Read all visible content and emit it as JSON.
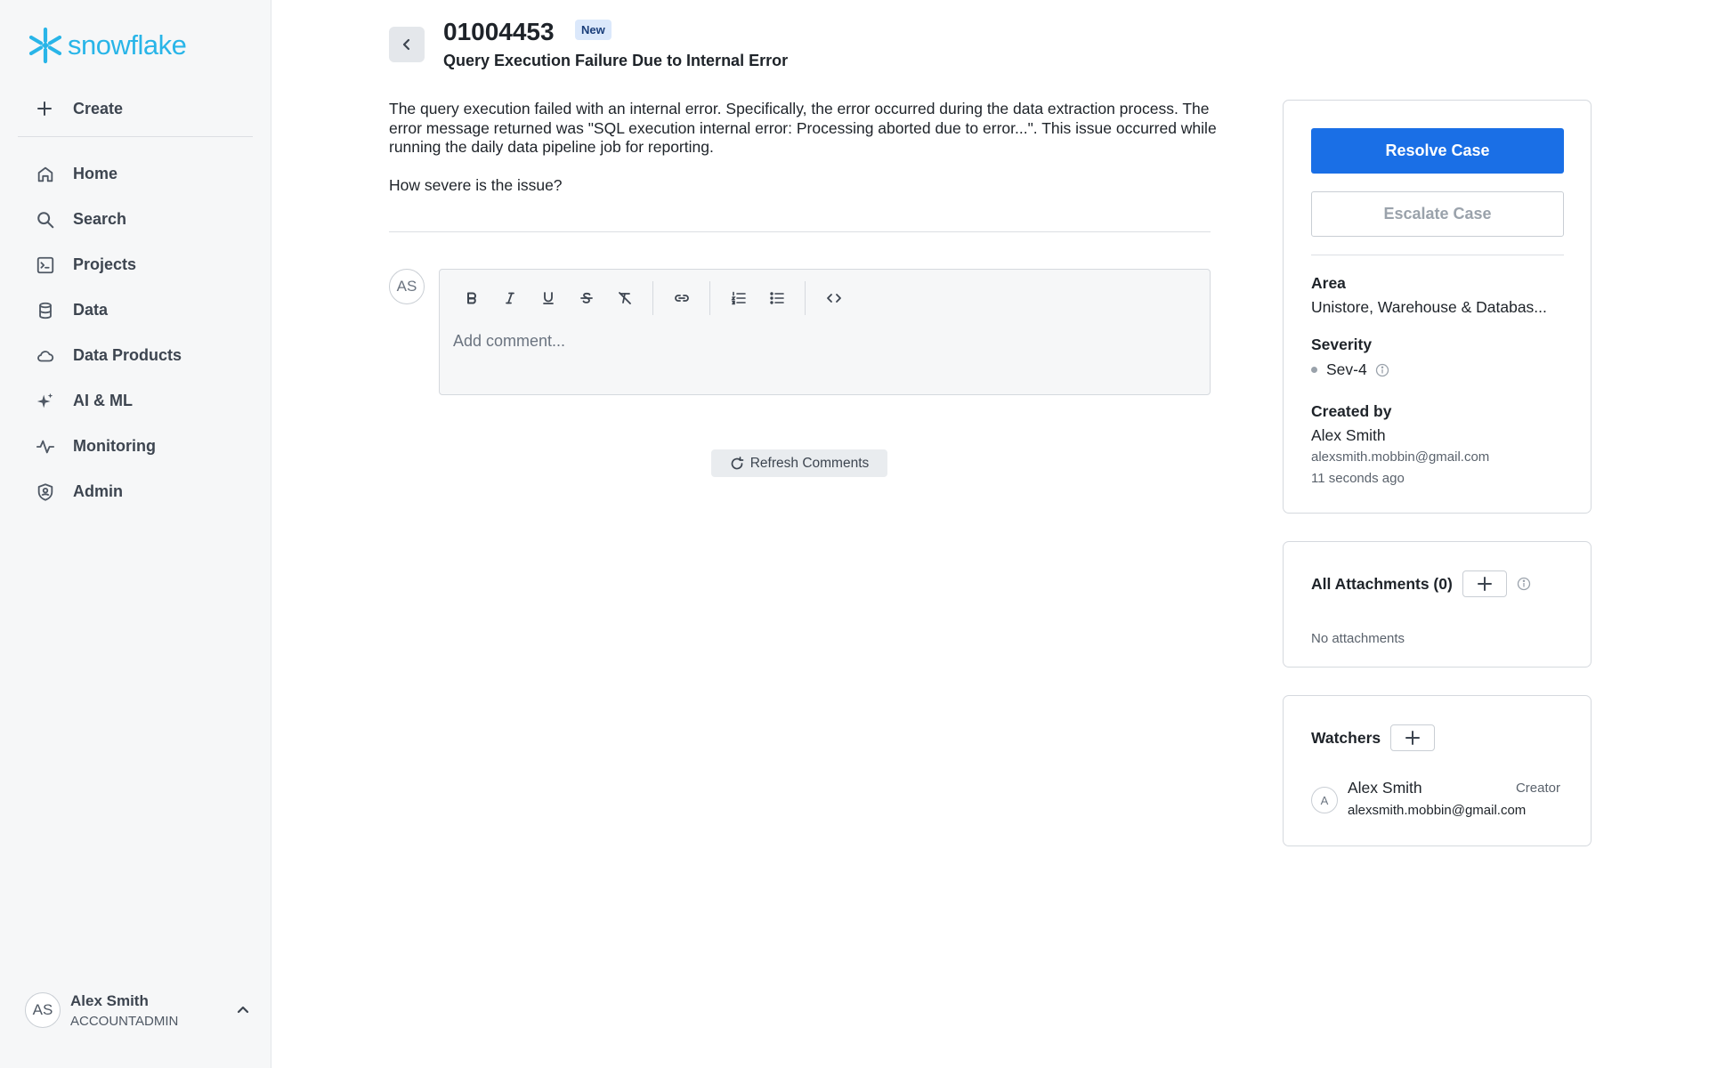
{
  "brand": {
    "name": "snowflake",
    "color": "#29b5e8"
  },
  "sidebar": {
    "create_label": "Create",
    "items": [
      {
        "label": "Home",
        "icon": "home-icon"
      },
      {
        "label": "Search",
        "icon": "search-icon"
      },
      {
        "label": "Projects",
        "icon": "terminal-icon"
      },
      {
        "label": "Data",
        "icon": "database-icon"
      },
      {
        "label": "Data Products",
        "icon": "cloud-icon"
      },
      {
        "label": "AI & ML",
        "icon": "sparkle-icon"
      },
      {
        "label": "Monitoring",
        "icon": "activity-icon"
      },
      {
        "label": "Admin",
        "icon": "shield-icon"
      }
    ],
    "user": {
      "initials": "AS",
      "name": "Alex Smith",
      "role": "ACCOUNTADMIN"
    }
  },
  "case": {
    "number": "01004453",
    "status_badge": "New",
    "title": "Query Execution Failure Due to Internal Error",
    "description": "The query execution failed with an internal error. Specifically, the error occurred during the data extraction process. The error message returned was \"SQL execution internal error: Processing aborted due to error...\". This issue occurred while running the daily data pipeline job for reporting.",
    "question": "How severe is the issue?"
  },
  "comment": {
    "avatar_initials": "AS",
    "placeholder": "Add comment...",
    "toolbar": [
      "bold-icon",
      "italic-icon",
      "underline-icon",
      "strikethrough-icon",
      "clear-format-icon",
      "link-icon",
      "ordered-list-icon",
      "bullet-list-icon",
      "code-icon"
    ],
    "refresh_label": "Refresh Comments"
  },
  "details": {
    "resolve_label": "Resolve Case",
    "escalate_label": "Escalate Case",
    "area_label": "Area",
    "area_value": "Unistore, Warehouse & Databas...",
    "severity_label": "Severity",
    "severity_value": "Sev-4",
    "created_label": "Created by",
    "created_name": "Alex Smith",
    "created_email": "alexsmith.mobbin@gmail.com",
    "created_time": "11 seconds ago",
    "accent_color": "#1a6fe6"
  },
  "attachments": {
    "title": "All Attachments (0)",
    "empty_text": "No attachments"
  },
  "watchers": {
    "title": "Watchers",
    "items": [
      {
        "initial": "A",
        "name": "Alex Smith",
        "role": "Creator",
        "email": "alexsmith.mobbin@gmail.com"
      }
    ]
  }
}
